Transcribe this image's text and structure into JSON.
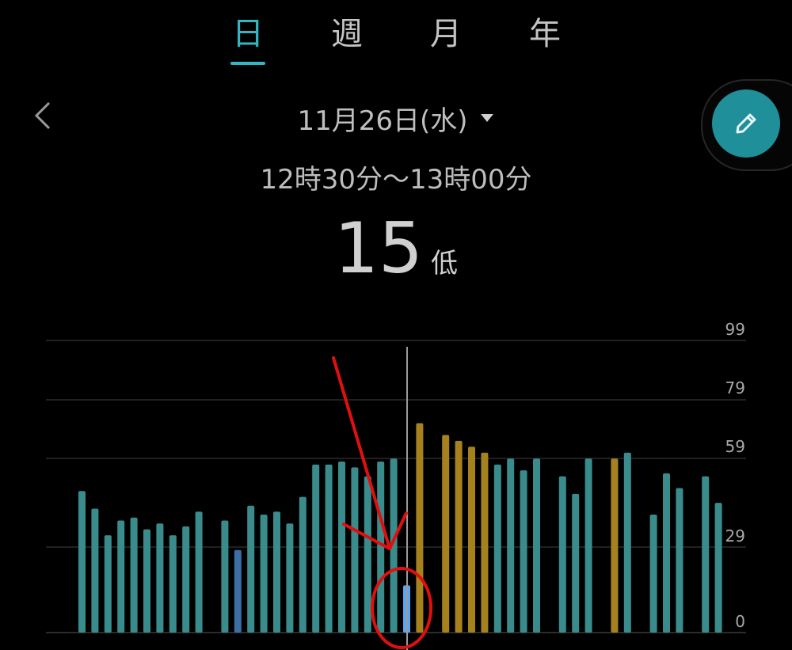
{
  "tabs": [
    {
      "label": "日",
      "active": true
    },
    {
      "label": "週",
      "active": false
    },
    {
      "label": "月",
      "active": false
    },
    {
      "label": "年",
      "active": false
    }
  ],
  "date": {
    "label": "11月26日(水)"
  },
  "time_range": "12時30分〜13時00分",
  "reading": {
    "value": "15",
    "level": "低"
  },
  "icons": {
    "back": "chevron-left-icon",
    "dropdown": "triangle-down-icon",
    "edit": "pencil-icon"
  },
  "colors": {
    "accent": "#33b7c6",
    "bar_normal": "#3a8c8c",
    "bar_high": "#a6821f",
    "bar_low": "#3d6ea6",
    "bar_selected": "#5aa6f2",
    "annotation": "#e01010"
  },
  "chart_data": {
    "type": "bar",
    "y_ticks": [
      99,
      79,
      59,
      29,
      0
    ],
    "ylim": [
      0,
      99
    ],
    "grid": true,
    "selected_index": 25,
    "series": [
      {
        "values": [
          48,
          42,
          33,
          38,
          39,
          35,
          37,
          33,
          36,
          41,
          null,
          38,
          28,
          43,
          40,
          41,
          37,
          46,
          57,
          57,
          58,
          56,
          53,
          58,
          59,
          16,
          71,
          null,
          67,
          65,
          63,
          61,
          57,
          59,
          55,
          59,
          null,
          53,
          47,
          59,
          null,
          59,
          61,
          null,
          40,
          54,
          49,
          null,
          53,
          44
        ]
      }
    ],
    "bar_status": [
      "n",
      "n",
      "n",
      "n",
      "n",
      "n",
      "n",
      "n",
      "n",
      "n",
      null,
      "n",
      "l",
      "n",
      "n",
      "n",
      "n",
      "n",
      "n",
      "n",
      "n",
      "n",
      "n",
      "n",
      "n",
      "s",
      "h",
      null,
      "h",
      "h",
      "h",
      "h",
      "n",
      "n",
      "n",
      "n",
      null,
      "n",
      "n",
      "n",
      null,
      "h",
      null,
      null,
      "n",
      "n",
      "n",
      null,
      "n",
      "n"
    ]
  }
}
